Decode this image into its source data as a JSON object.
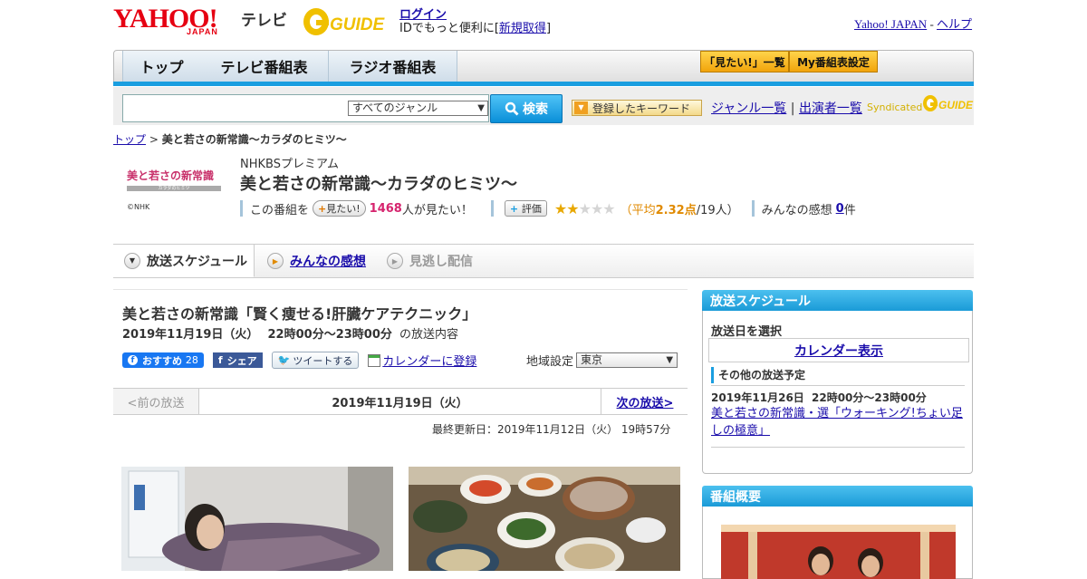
{
  "header": {
    "yahoo_logo": "YAHOO!",
    "japan_logo": "JAPAN",
    "tv_label": "テレビ",
    "gguide_logo": "GUIDE",
    "login": "ログイン",
    "id_note_prefix": "IDでもっと便利に[",
    "signup": "新規取得",
    "id_note_suffix": "]",
    "yahoo_japan_link": "Yahoo! JAPAN",
    "separator": " - ",
    "help_link": "ヘルプ"
  },
  "nav": {
    "tabs": [
      "トップ",
      "テレビ番組表",
      "ラジオ番組表"
    ],
    "want_list_button": "「見たい!」一覧",
    "my_schedule_button": "My番組表設定"
  },
  "search": {
    "genre_selected": "すべてのジャンル",
    "search_button": "検索",
    "keyword_button": "登録したキーワード",
    "genre_list_link": "ジャンル一覧",
    "divider": "|",
    "performer_list_link": "出演者一覧",
    "syndicated": "Syndicated"
  },
  "breadcrumb": {
    "top": "トップ",
    "sep": " > ",
    "current": "美と若さの新常識～カラダのヒミツ～"
  },
  "program": {
    "thumb_title": "美と若さの新常識",
    "thumb_sub": "カラダのヒミツ",
    "thumb_credit": "©NHK",
    "channel": "NHKBSプレミアム",
    "title": "美と若さの新常識～カラダのヒミツ～",
    "want_prefix": "この番組を",
    "want_button": "見たい!",
    "want_count": "1468",
    "want_suffix": "人が見たい！",
    "rate_button": "評価",
    "rating_open": "（平均",
    "rating_avg": "2.32点",
    "rating_votes": "/19人）",
    "rating_value": 2.32,
    "impressions_label": "みんなの感想",
    "impressions_count": "0",
    "impressions_unit": "件"
  },
  "tabs": {
    "schedule": "放送スケジュール",
    "impressions": "みんなの感想",
    "streaming": "見逃し配信"
  },
  "episode": {
    "title": "美と若さの新常識「賢く痩せる!肝臓ケアテクニック」",
    "date": "2019年11月19日（火）",
    "time": "22時00分～23時00分",
    "date_suffix": "の放送内容",
    "fb_label": "おすすめ",
    "fb_count": "28",
    "share_label": "シェア",
    "tweet_label": "ツイートする",
    "calendar_link": "カレンダーに登録",
    "region_label": "地域設定",
    "region_selected": "東京",
    "prev": "<前の放送",
    "nav_date": "2019年11月19日（火）",
    "next": "次の放送>",
    "updated": "最終更新日：2019年11月12日（火） 19時57分"
  },
  "sidebar": {
    "schedule_header": "放送スケジュール",
    "select_date": "放送日を選択",
    "calendar_link": "カレンダー表示",
    "other_schedule": "その他の放送予定",
    "other_date": "2019年11月26日",
    "other_time": "22時00分～23時00分",
    "other_title": "美と若さの新常識・選「ウォーキング!ちょい足しの極意」",
    "overview_header": "番組概要"
  },
  "colors": {
    "accent_blue": "#1a9ee0",
    "yahoo_red": "#e60012",
    "want_pink": "#d6246e",
    "rating_orange": "#e08a00"
  }
}
